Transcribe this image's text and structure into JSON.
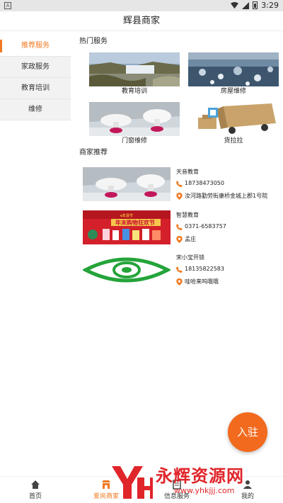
{
  "status_bar": {
    "time": "3:29",
    "app_badge": "A"
  },
  "title": "辉县商家",
  "sidebar": {
    "items": [
      {
        "label": "推荐服务",
        "active": true
      },
      {
        "label": "家政服务",
        "active": false
      },
      {
        "label": "教育培训",
        "active": false
      },
      {
        "label": "维修",
        "active": false
      }
    ]
  },
  "hot_services": {
    "title": "热门服务",
    "items": [
      {
        "label": "教育培训",
        "image": "waterfall-landscape"
      },
      {
        "label": "房屋维修",
        "image": "frozen-water"
      },
      {
        "label": "门窗维修",
        "image": "mushroom-scene"
      },
      {
        "label": "货拉拉",
        "image": "delivery-truck"
      }
    ]
  },
  "merchants": {
    "title": "商家推荐",
    "items": [
      {
        "name": "天音教育",
        "phone": "18738473050",
        "address": "汝河路勤劳街康桥金城上郡1号院",
        "image": "mushroom-scene"
      },
      {
        "name": "智慧教育",
        "phone": "0371-6583757",
        "address": "孟庄",
        "image": "promo-banner",
        "banner_top": "e年货节",
        "banner_main": "年末购物狂欢节"
      },
      {
        "name": "宋小宝开锁",
        "phone": "18135822583",
        "address": "哇哈来呜哦哦",
        "image": "green-eye-logo"
      }
    ]
  },
  "join_button": {
    "label": "入驻"
  },
  "bottom_nav": {
    "items": [
      {
        "label": "首页",
        "icon": "home-icon",
        "active": false
      },
      {
        "label": "爱尚商家",
        "icon": "shop-icon",
        "active": true
      },
      {
        "label": "信息服务",
        "icon": "info-icon",
        "active": false
      },
      {
        "label": "我的",
        "icon": "user-icon",
        "active": false
      }
    ]
  },
  "watermark": {
    "text": "永辉资源网",
    "url": "www.yhkjjj.com"
  },
  "colors": {
    "accent": "#f07a23",
    "join_button": "#f26a1e",
    "watermark": "#e0252a"
  }
}
